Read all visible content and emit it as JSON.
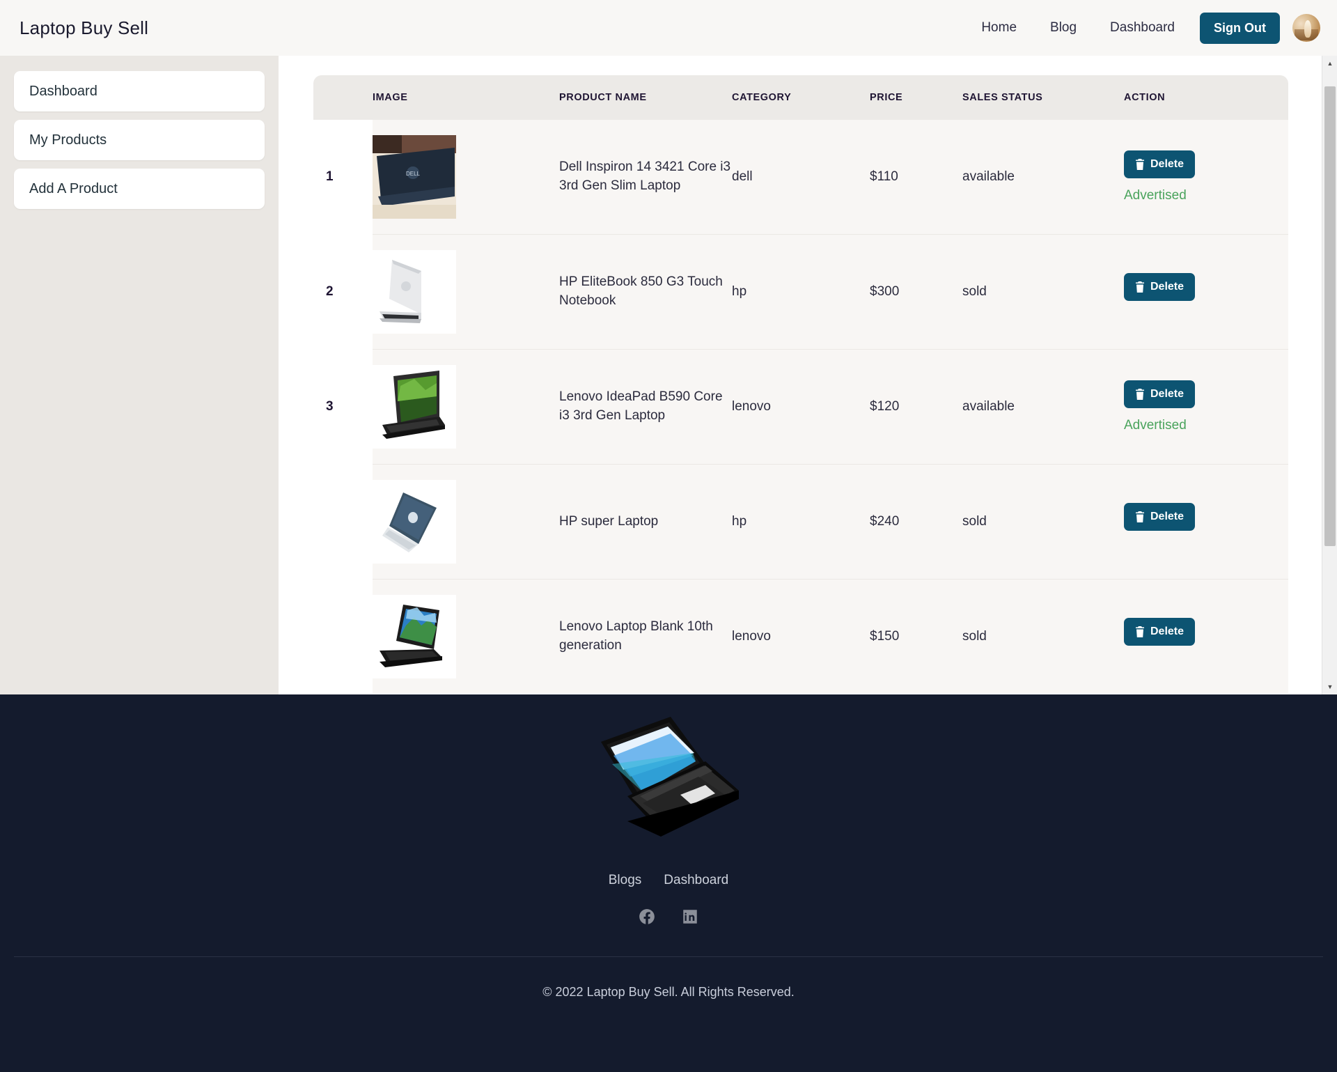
{
  "navbar": {
    "brand": "Laptop Buy Sell",
    "links": [
      {
        "label": "Home"
      },
      {
        "label": "Blog"
      },
      {
        "label": "Dashboard"
      }
    ],
    "signout_label": "Sign Out",
    "avatar_alt": "user-avatar"
  },
  "sidebar": {
    "items": [
      {
        "label": "Dashboard"
      },
      {
        "label": "My Products"
      },
      {
        "label": "Add A Product"
      }
    ]
  },
  "table": {
    "columns": [
      "",
      "IMAGE",
      "PRODUCT NAME",
      "CATEGORY",
      "PRICE",
      "SALES STATUS",
      "ACTION"
    ],
    "delete_label": "Delete",
    "advertised_label": "Advertised",
    "rows": [
      {
        "index": "1",
        "image": "dell-inspiron-thumbnail",
        "name": "Dell Inspiron 14 3421 Core i3 3rd Gen Slim Laptop",
        "category": "dell",
        "price": "$110",
        "status": "available",
        "advertised": "Advertised"
      },
      {
        "index": "2",
        "image": "hp-elitebook-thumbnail",
        "name": "HP EliteBook 850 G3 Touch Notebook",
        "category": "hp",
        "price": "$300",
        "status": "sold",
        "advertised": ""
      },
      {
        "index": "3",
        "image": "lenovo-ideapad-thumbnail",
        "name": "Lenovo IdeaPad B590 Core i3 3rd Gen Laptop",
        "category": "lenovo",
        "price": "$120",
        "status": "available",
        "advertised": "Advertised"
      },
      {
        "index": "",
        "image": "hp-super-thumbnail",
        "name": "HP super Laptop",
        "category": "hp",
        "price": "$240",
        "status": "sold",
        "advertised": ""
      },
      {
        "index": "",
        "image": "lenovo-blank-thumbnail",
        "name": "Lenovo Laptop Blank 10th generation",
        "category": "lenovo",
        "price": "$150",
        "status": "sold",
        "advertised": ""
      }
    ]
  },
  "footer": {
    "logo_alt": "laptop-illustration",
    "links": [
      {
        "label": "Blogs"
      },
      {
        "label": "Dashboard"
      }
    ],
    "socials": [
      {
        "name": "facebook-icon"
      },
      {
        "name": "linkedin-icon"
      }
    ],
    "copyright": "© 2022 Laptop Buy Sell. All Rights Reserved."
  },
  "colors": {
    "accent": "#0d5472",
    "footer_bg": "#141b2d",
    "sidebar_bg": "#eae7e3",
    "advertised": "#4aa35c"
  }
}
